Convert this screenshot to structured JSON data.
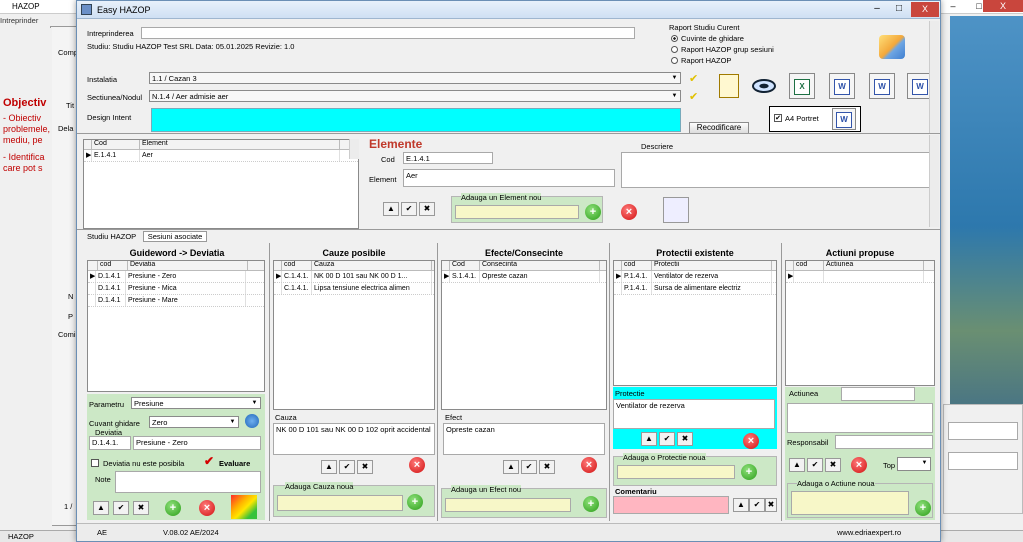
{
  "background": {
    "app_title": "HAZOP",
    "subtitle": "Intreprinder",
    "inner_tab": "Comp",
    "side_title": "Objectiv",
    "side_lines": [
      "- Obiectiv",
      "problemele,",
      "mediu, pe",
      "- Identifica",
      "care pot s"
    ],
    "side_col": "Tit",
    "side_del": "Dela",
    "side_misc": [
      "N",
      "P",
      "Comi"
    ],
    "bottom": "1 /",
    "taskbar": "HAZOP"
  },
  "window": {
    "title": "Easy HAZOP",
    "controls": [
      "–",
      "□",
      "X"
    ]
  },
  "header": {
    "intreprindere_label": "Intreprinderea",
    "intreprindere_value": "",
    "studiu_line": "Studiu: Studiu HAZOP Test SRL  Data: 05.01.2025  Revizie: 1.0",
    "raport_title": "Raport Studiu Curent",
    "raport_options": [
      "Cuvinte de ghidare",
      "Raport HAZOP grup sesiuni",
      "Raport HAZOP"
    ],
    "raport_selected": 0,
    "instalatia_label": "Instalatia",
    "instalatia_value": "1.1 / Cazan 3",
    "sectiunea_label": "Sectiunea/Nodul",
    "sectiunea_value": "N.1.4 / Aer admisie aer",
    "design_intent_label": "Design Intent",
    "design_intent_value": "",
    "recodificare": "Recodificare",
    "a4_label": "A4 Portret",
    "a4_checked": true
  },
  "elemente": {
    "grid_cols": [
      "Cod",
      "Element"
    ],
    "rows": [
      {
        "cod": "E.1.4.1",
        "element": "Aer"
      }
    ],
    "title": "Elemente",
    "cod_label": "Cod",
    "cod_value": "E.1.4.1",
    "element_label": "Element",
    "element_value": "Aer",
    "descriere_label": "Descriere",
    "adauga_label": "Adauga un Element nou"
  },
  "tabs": [
    "Studiu HAZOP",
    "Sesiuni asociate"
  ],
  "guideword": {
    "title": "Guideword -> Deviatia",
    "cols": [
      "cod",
      "Deviatia"
    ],
    "rows": [
      {
        "cod": "D.1.4.1",
        "dev": "Presiune - Zero"
      },
      {
        "cod": "D.1.4.1",
        "dev": "Presiune - Mica"
      },
      {
        "cod": "D.1.4.1",
        "dev": "Presiune - Mare"
      }
    ],
    "parametru_label": "Parametru",
    "parametru_value": "Presiune",
    "cuvant_label": "Cuvant ghidare",
    "cuvant_value": "Zero",
    "deviatia_label": "Deviatia",
    "deviatia_cod": "D.1.4.1.",
    "deviatia_value": "Presiune - Zero",
    "nu_posibila": "Deviatia nu este posibila",
    "evaluare": "Evaluare",
    "note": "Note"
  },
  "cauze": {
    "title": "Cauze posibile",
    "cols": [
      "cod",
      "Cauza"
    ],
    "rows": [
      {
        "cod": "C.1.4.1.",
        "txt": "NK 00 D 101 sau NK 00 D 1..."
      },
      {
        "cod": "C.1.4.1.",
        "txt": "Lipsa tensiune electrica alimen"
      }
    ],
    "cauza_label": "Cauza",
    "cauza_value": "NK 00 D 101 sau NK 00 D 102 oprit accidental",
    "adauga": "Adauga Cauza noua"
  },
  "efecte": {
    "title": "Efecte/Consecinte",
    "cols": [
      "Cod",
      "Consecinta"
    ],
    "rows": [
      {
        "cod": "S.1.4.1.",
        "txt": "Opreste cazan"
      }
    ],
    "efect_label": "Efect",
    "efect_value": "Opreste cazan",
    "adauga": "Adauga un Efect nou"
  },
  "protectii": {
    "title": "Protectii existente",
    "cols": [
      "cod",
      "Protectii"
    ],
    "rows": [
      {
        "cod": "P.1.4.1.",
        "txt": "Ventilator de rezerva"
      },
      {
        "cod": "P.1.4.1.",
        "txt": "Sursa de alimentare electriz"
      }
    ],
    "protectie_label": "Protectie",
    "protectie_value": "Ventilator de rezerva",
    "adauga": "Adauga o Protectie noua",
    "comentariu": "Comentariu"
  },
  "actiuni": {
    "title": "Actiuni propuse",
    "cols": [
      "cod",
      "Actiunea"
    ],
    "actiunea_label": "Actiunea",
    "responsabil_label": "Responsabil",
    "top_label": "Top",
    "adauga": "Adauga o Actiune noua"
  },
  "status": {
    "user": "AE",
    "version": "V.08.02 AE/2024",
    "site": "www.edriaexpert.ro"
  },
  "colors": {
    "cyan": "#00ffff",
    "green_panel": "#cce8c6",
    "pink": "#ffb6c1",
    "accent_red": "#c0392b"
  }
}
